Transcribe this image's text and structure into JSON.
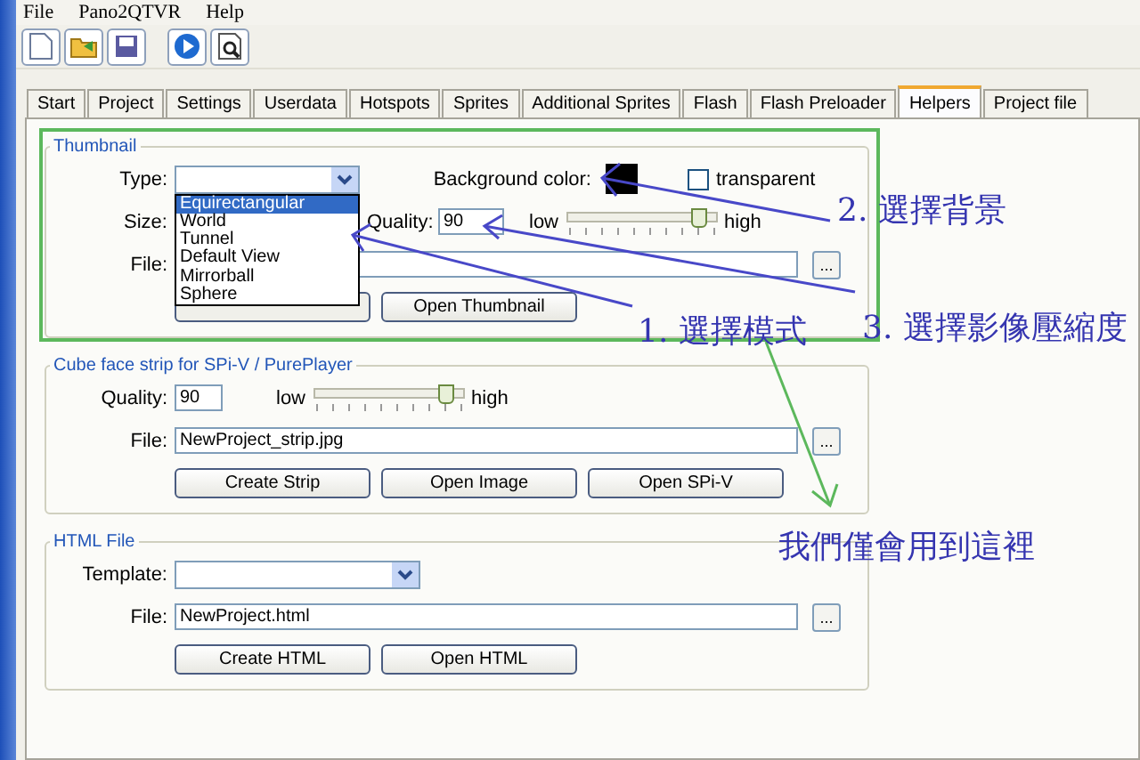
{
  "menu": [
    "File",
    "Pano2QTVR",
    "Help"
  ],
  "tabs": [
    {
      "label": "Start",
      "selected": false
    },
    {
      "label": "Project",
      "selected": false
    },
    {
      "label": "Settings",
      "selected": false
    },
    {
      "label": "Userdata",
      "selected": false
    },
    {
      "label": "Hotspots",
      "selected": false
    },
    {
      "label": "Sprites",
      "selected": false
    },
    {
      "label": "Additional Sprites",
      "selected": false
    },
    {
      "label": "Flash",
      "selected": false
    },
    {
      "label": "Flash Preloader",
      "selected": false
    },
    {
      "label": "Helpers",
      "selected": true
    },
    {
      "label": "Project file",
      "selected": false
    }
  ],
  "thumbnail": {
    "title": "Thumbnail",
    "type_label": "Type:",
    "type_options": [
      {
        "label": "Equirectangular",
        "selected": true
      },
      {
        "label": "World",
        "selected": false
      },
      {
        "label": "Tunnel",
        "selected": false
      },
      {
        "label": "Default View",
        "selected": false
      },
      {
        "label": "Mirrorball",
        "selected": false
      },
      {
        "label": "Sphere",
        "selected": false
      }
    ],
    "background_label": "Background color:",
    "transparent": {
      "label": "transparent",
      "checked": false
    },
    "size_label": "Size:",
    "quality_label": "Quality:",
    "quality_value": "90",
    "low": "low",
    "high": "high",
    "level": 0.9,
    "file_label": "File:",
    "browse": "...",
    "buttons": [
      "Open Thumbnail"
    ]
  },
  "cube_strip": {
    "title": "Cube face strip for SPi-V / PurePlayer",
    "quality_label": "Quality:",
    "quality_value": "90",
    "low": "low",
    "high": "high",
    "level": 0.9,
    "file_label": "File:",
    "file_value": "NewProject_strip.jpg",
    "browse": "...",
    "buttons": [
      "Create Strip",
      "Open Image",
      "Open SPi-V"
    ]
  },
  "html_file": {
    "title": "HTML File",
    "template_label": "Template:",
    "file_label": "File:",
    "file_value": "NewProject.html",
    "browse": "...",
    "buttons": [
      "Create HTML",
      "Open HTML"
    ]
  },
  "annotations": [
    {
      "text": "2. 選擇背景"
    },
    {
      "text": "1. 選擇模式"
    },
    {
      "text": "3. 選擇影像壓縮度"
    },
    {
      "text": "我們僅會用到這裡"
    }
  ]
}
